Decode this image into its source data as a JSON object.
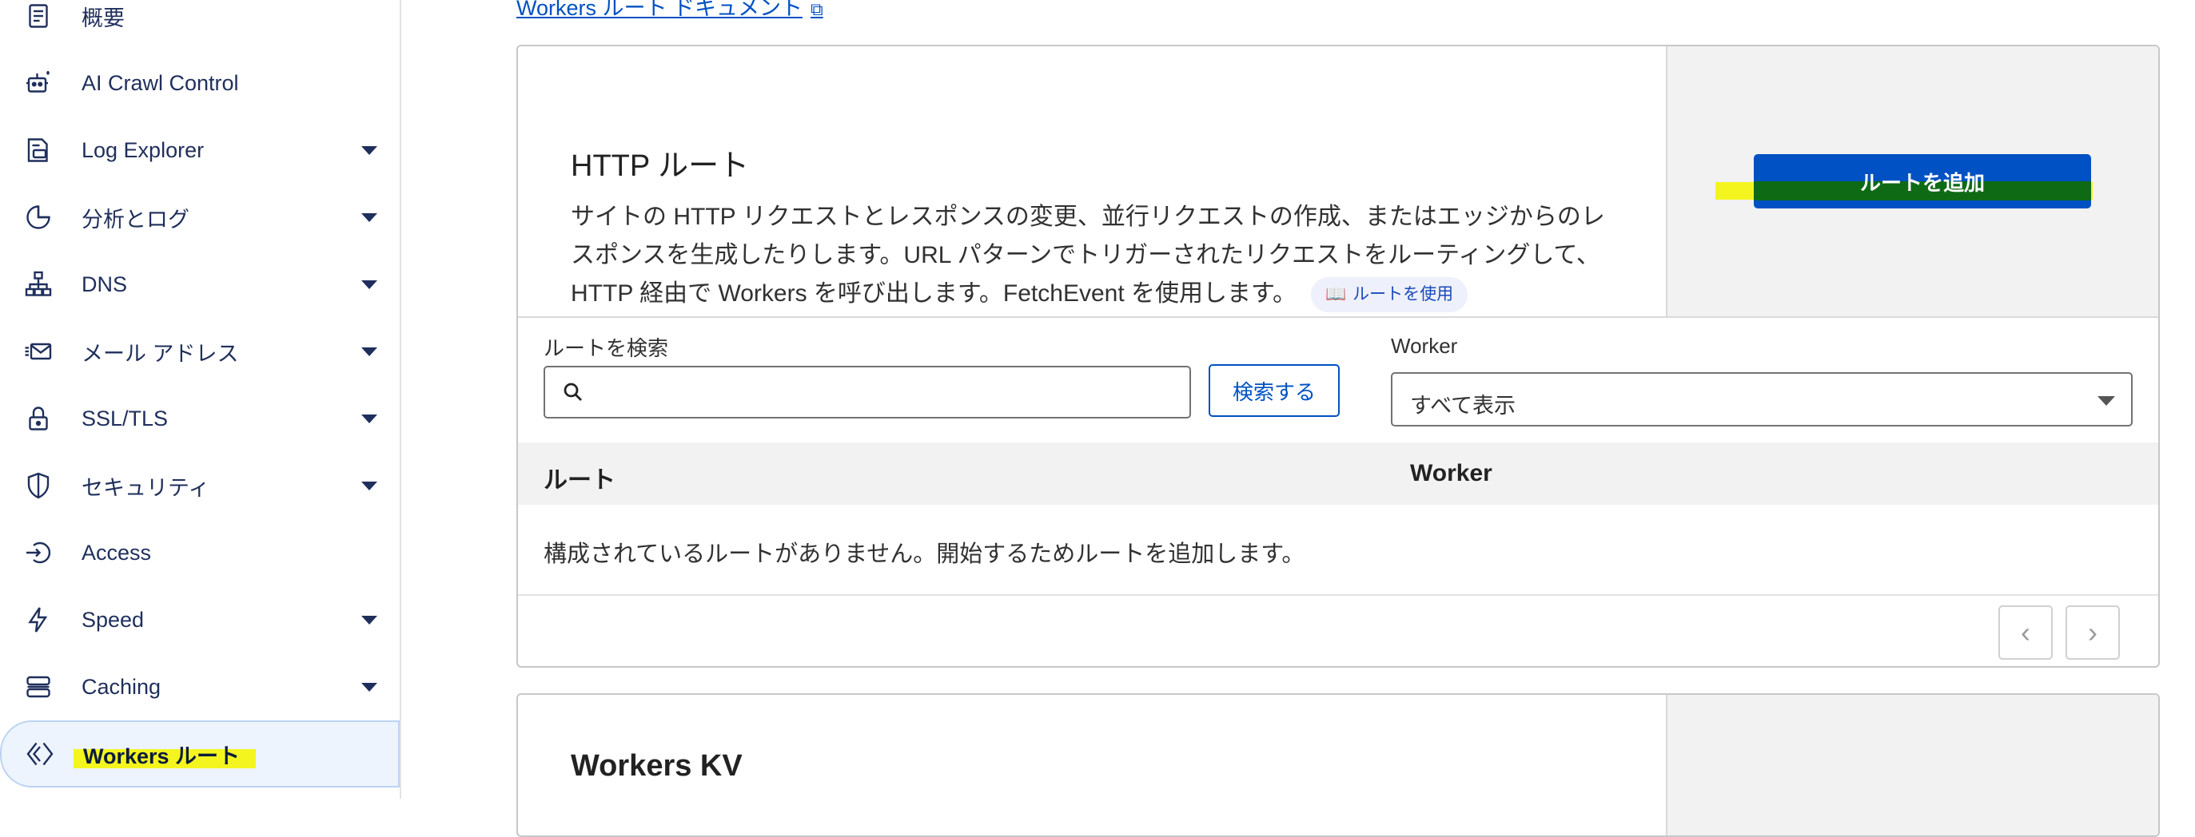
{
  "sidebar": {
    "items": [
      {
        "label": "概要",
        "icon": "document-icon",
        "has_caret": false
      },
      {
        "label": "AI Crawl Control",
        "icon": "robot-icon",
        "has_caret": false
      },
      {
        "label": "Log Explorer",
        "icon": "log-icon",
        "has_caret": true
      },
      {
        "label": "分析とログ",
        "icon": "pie-chart-icon",
        "has_caret": true
      },
      {
        "label": "DNS",
        "icon": "network-icon",
        "has_caret": true
      },
      {
        "label": "メール アドレス",
        "icon": "mail-icon",
        "has_caret": true
      },
      {
        "label": "SSL/TLS",
        "icon": "lock-icon",
        "has_caret": true
      },
      {
        "label": "セキュリティ",
        "icon": "shield-icon",
        "has_caret": true
      },
      {
        "label": "Access",
        "icon": "access-icon",
        "has_caret": false
      },
      {
        "label": "Speed",
        "icon": "lightning-icon",
        "has_caret": true
      },
      {
        "label": "Caching",
        "icon": "server-icon",
        "has_caret": true
      },
      {
        "label": "Workers ルート",
        "icon": "workers-icon",
        "has_caret": false,
        "active": true
      }
    ]
  },
  "main": {
    "doc_link": "Workers ルート ドキュメント",
    "http_routes": {
      "title": "HTTP ルート",
      "description": "サイトの HTTP リクエストとレスポンスの変更、並行リクエストの作成、またはエッジからのレスポンスを生成したりします。URL パターンでトリガーされたリクエストをルーティングして、HTTP 経由で Workers を呼び出します。FetchEvent を使用します。",
      "use_routes_pill": "ルートを使用",
      "add_route_button": "ルートを追加",
      "search_label": "ルートを検索",
      "search_placeholder": "",
      "search_button": "検索する",
      "worker_label": "Worker",
      "worker_select_value": "すべて表示",
      "table_headers": [
        "ルート",
        "Worker"
      ],
      "empty_message": "構成されているルートがありません。開始するためルートを追加します。",
      "pager_prev": "‹",
      "pager_next": "›"
    },
    "workers_kv": {
      "title": "Workers KV"
    }
  },
  "colors": {
    "accent": "#0051c3",
    "highlight": "#f4f51e",
    "nav_text": "#1f2f5c",
    "active_bg": "#eef4fd"
  }
}
